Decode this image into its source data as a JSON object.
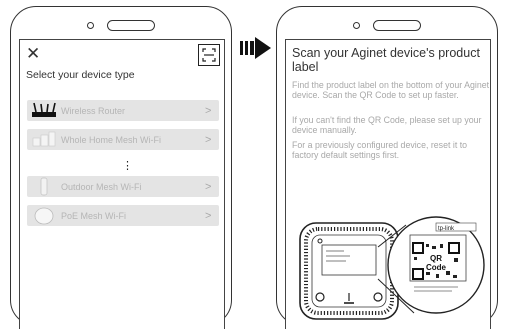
{
  "left_phone": {
    "close_icon": "close-icon",
    "scan_icon": "qr-scan-icon",
    "title": "Select your device type",
    "devices": [
      {
        "label": "Wireless Router",
        "icon": "router-icon"
      },
      {
        "label": "Whole Home Mesh Wi-Fi",
        "icon": "mesh-icon"
      },
      {
        "label": "Outdoor Mesh Wi-Fi",
        "icon": "outdoor-icon"
      },
      {
        "label": "PoE Mesh Wi-Fi",
        "icon": "poe-icon"
      }
    ],
    "more_indicator": "⋮",
    "chevron": ">"
  },
  "arrow_icon": "arrow-right-icon",
  "right_phone": {
    "title": "Scan your Aginet device's product label",
    "paragraphs": [
      "Find the product label on the bottom of your Aginet device. Scan the QR Code to set up faster.",
      "If you can't find the QR Code, please set up your device manually.",
      "For a previously configured device, reset it to factory default settings first."
    ],
    "label_brand": "tp-link",
    "qr_text_line1": "QR",
    "qr_text_line2": "Code"
  }
}
